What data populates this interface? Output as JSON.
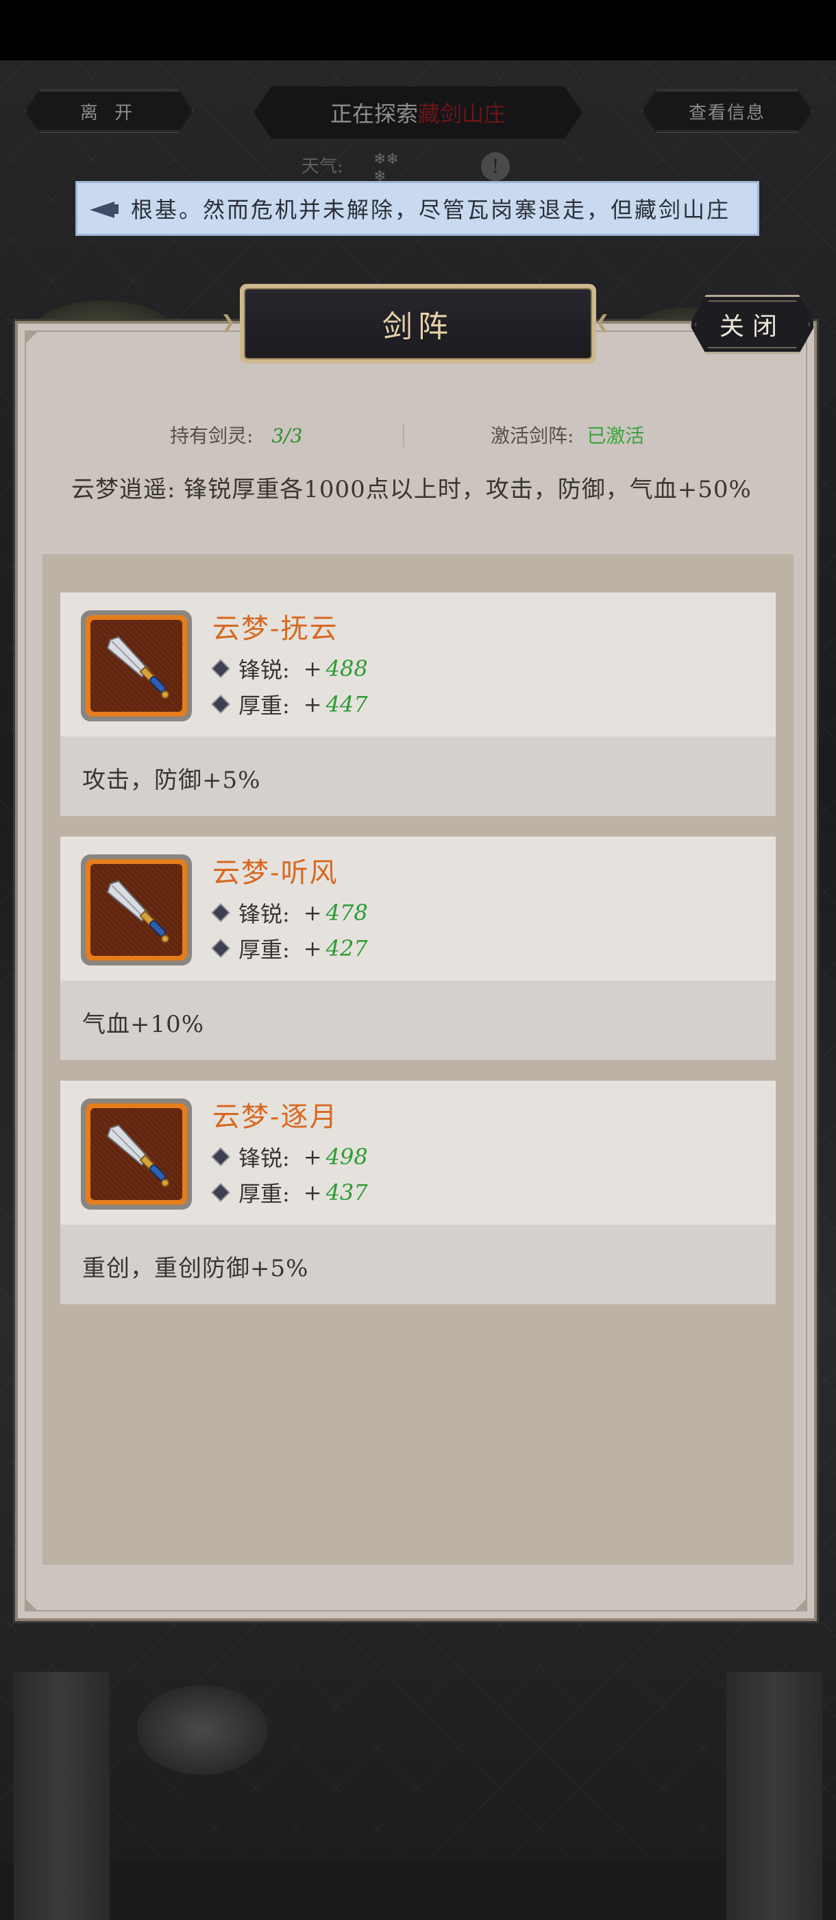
{
  "hud": {
    "leave_label": "离 开",
    "exploring_prefix": "正在探索",
    "exploring_location": "藏剑山庄",
    "info_label": "查看信息",
    "weather_label": "天气:",
    "alert_symbol": "!"
  },
  "marquee": {
    "text": "根基。然而危机并未解除，尽管瓦岗寨退走，但藏剑山庄"
  },
  "dialog": {
    "title": "剑阵",
    "close_label": "关闭",
    "owned_label": "持有剑灵:",
    "owned_value": "3/3",
    "activated_label": "激活剑阵:",
    "activated_value": "已激活",
    "bonus_text": "云梦逍遥: 锋锐厚重各1000点以上时，攻击，防御，气血+50%"
  },
  "cards": [
    {
      "name": "云梦-抚云",
      "sharp_label": "锋锐:",
      "sharp_plus": "+",
      "sharp_value": "488",
      "heavy_label": "厚重:",
      "heavy_plus": "+",
      "heavy_value": "447",
      "effect": "攻击，防御+5%"
    },
    {
      "name": "云梦-听风",
      "sharp_label": "锋锐:",
      "sharp_plus": "+",
      "sharp_value": "478",
      "heavy_label": "厚重:",
      "heavy_plus": "+",
      "heavy_value": "427",
      "effect": "气血+10%"
    },
    {
      "name": "云梦-逐月",
      "sharp_label": "锋锐:",
      "sharp_plus": "+",
      "sharp_value": "498",
      "heavy_label": "厚重:",
      "heavy_plus": "+",
      "heavy_value": "437",
      "effect": "重创，重创防御+5%"
    }
  ],
  "colors": {
    "accent_orange": "#d8681f",
    "value_green": "#2e9b35",
    "location_red": "#6a1616"
  }
}
